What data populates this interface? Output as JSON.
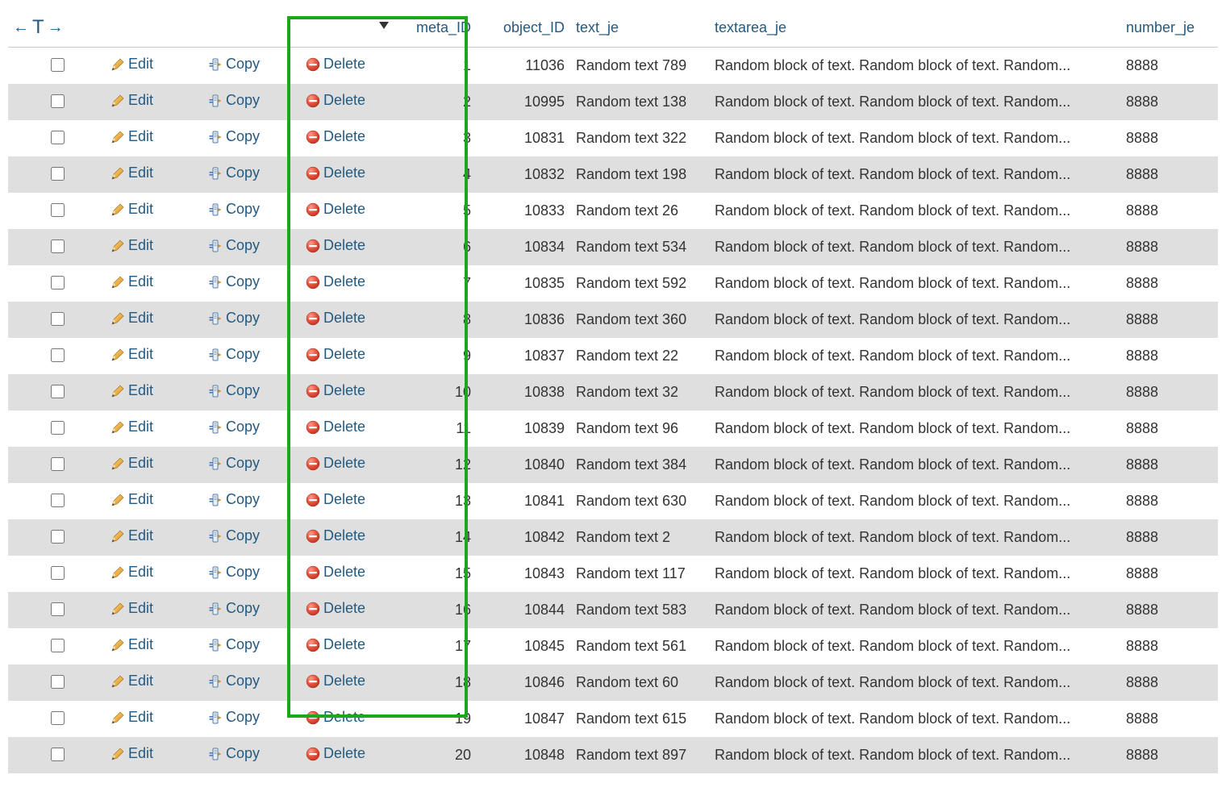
{
  "header": {
    "toggle_left_arrow": "←",
    "toggle_T": "T",
    "toggle_right_arrow": "→",
    "col_meta": "meta_ID",
    "col_object": "object_ID",
    "col_text": "text_je",
    "col_textarea": "textarea_je",
    "col_number": "number_je"
  },
  "labels": {
    "edit": "Edit",
    "copy": "Copy",
    "delete": "Delete"
  },
  "rows": [
    {
      "meta_ID": "1",
      "object_ID": "11036",
      "text_je": "Random text 789",
      "textarea_je": "Random block of text. Random block of text. Random...",
      "number_je": "8888"
    },
    {
      "meta_ID": "2",
      "object_ID": "10995",
      "text_je": "Random text 138",
      "textarea_je": "Random block of text. Random block of text. Random...",
      "number_je": "8888"
    },
    {
      "meta_ID": "3",
      "object_ID": "10831",
      "text_je": "Random text 322",
      "textarea_je": "Random block of text. Random block of text. Random...",
      "number_je": "8888"
    },
    {
      "meta_ID": "4",
      "object_ID": "10832",
      "text_je": "Random text 198",
      "textarea_je": "Random block of text. Random block of text. Random...",
      "number_je": "8888"
    },
    {
      "meta_ID": "5",
      "object_ID": "10833",
      "text_je": "Random text 26",
      "textarea_je": "Random block of text. Random block of text. Random...",
      "number_je": "8888"
    },
    {
      "meta_ID": "6",
      "object_ID": "10834",
      "text_je": "Random text 534",
      "textarea_je": "Random block of text. Random block of text. Random...",
      "number_je": "8888"
    },
    {
      "meta_ID": "7",
      "object_ID": "10835",
      "text_je": "Random text 592",
      "textarea_je": "Random block of text. Random block of text. Random...",
      "number_je": "8888"
    },
    {
      "meta_ID": "8",
      "object_ID": "10836",
      "text_je": "Random text 360",
      "textarea_je": "Random block of text. Random block of text. Random...",
      "number_je": "8888"
    },
    {
      "meta_ID": "9",
      "object_ID": "10837",
      "text_je": "Random text 22",
      "textarea_je": "Random block of text. Random block of text. Random...",
      "number_je": "8888"
    },
    {
      "meta_ID": "10",
      "object_ID": "10838",
      "text_je": "Random text 32",
      "textarea_je": "Random block of text. Random block of text. Random...",
      "number_je": "8888"
    },
    {
      "meta_ID": "11",
      "object_ID": "10839",
      "text_je": "Random text 96",
      "textarea_je": "Random block of text. Random block of text. Random...",
      "number_je": "8888"
    },
    {
      "meta_ID": "12",
      "object_ID": "10840",
      "text_je": "Random text 384",
      "textarea_je": "Random block of text. Random block of text. Random...",
      "number_je": "8888"
    },
    {
      "meta_ID": "13",
      "object_ID": "10841",
      "text_je": "Random text 630",
      "textarea_je": "Random block of text. Random block of text. Random...",
      "number_je": "8888"
    },
    {
      "meta_ID": "14",
      "object_ID": "10842",
      "text_je": "Random text 2",
      "textarea_je": "Random block of text. Random block of text. Random...",
      "number_je": "8888"
    },
    {
      "meta_ID": "15",
      "object_ID": "10843",
      "text_je": "Random text 117",
      "textarea_je": "Random block of text. Random block of text. Random...",
      "number_je": "8888"
    },
    {
      "meta_ID": "16",
      "object_ID": "10844",
      "text_je": "Random text 583",
      "textarea_je": "Random block of text. Random block of text. Random...",
      "number_je": "8888"
    },
    {
      "meta_ID": "17",
      "object_ID": "10845",
      "text_je": "Random text 561",
      "textarea_je": "Random block of text. Random block of text. Random...",
      "number_je": "8888"
    },
    {
      "meta_ID": "18",
      "object_ID": "10846",
      "text_je": "Random text 60",
      "textarea_je": "Random block of text. Random block of text. Random...",
      "number_je": "8888"
    },
    {
      "meta_ID": "19",
      "object_ID": "10847",
      "text_je": "Random text 615",
      "textarea_je": "Random block of text. Random block of text. Random...",
      "number_je": "8888"
    },
    {
      "meta_ID": "20",
      "object_ID": "10848",
      "text_je": "Random text 897",
      "textarea_je": "Random block of text. Random block of text. Random...",
      "number_je": "8888"
    }
  ]
}
